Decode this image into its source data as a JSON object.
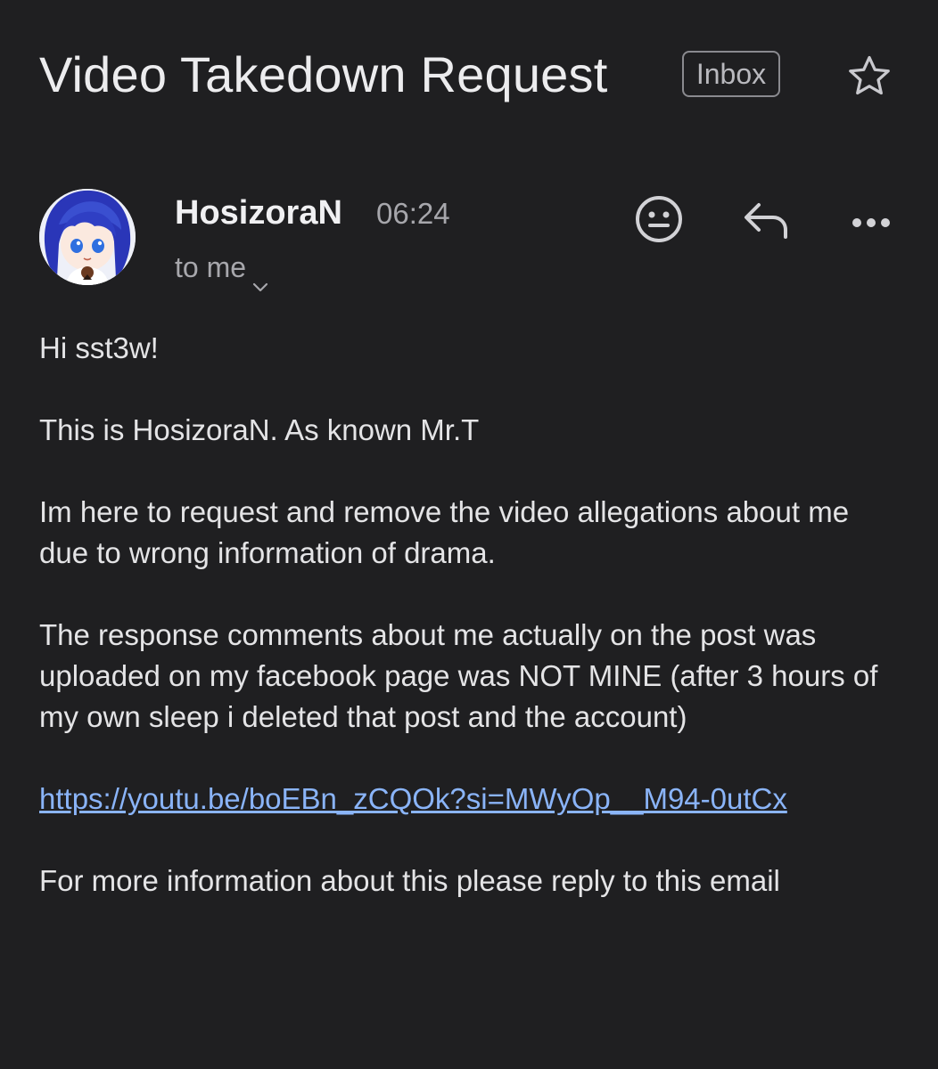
{
  "subject": "Video Takedown Request",
  "label": "Inbox",
  "sender": {
    "name": "HosizoraN",
    "time": "06:24",
    "recipients": "to me"
  },
  "icons": {
    "star": "star-icon",
    "emoji": "emoji-reaction-icon",
    "reply": "reply-icon",
    "more": "more-horizontal-icon",
    "chevron": "chevron-down-icon"
  },
  "colors": {
    "background": "#1f1f21",
    "link": "#8ab4f8",
    "text": "#e4e4e6",
    "muted": "#a7a7ac"
  },
  "message": {
    "greeting": "Hi sst3w!",
    "intro": "This is HosizoraN. As known Mr.T",
    "request": "Im here to request and remove the video allegations about me due to wrong information of drama.",
    "explanation": "The response comments about me actually on the post was uploaded on my facebook page was NOT MINE (after 3 hours of my own sleep i deleted that post and the account)",
    "link": "https://youtu.be/boEBn_zCQOk?si=MWyOp__M94-0utCx",
    "closing": "For more information about this please reply to this email"
  }
}
